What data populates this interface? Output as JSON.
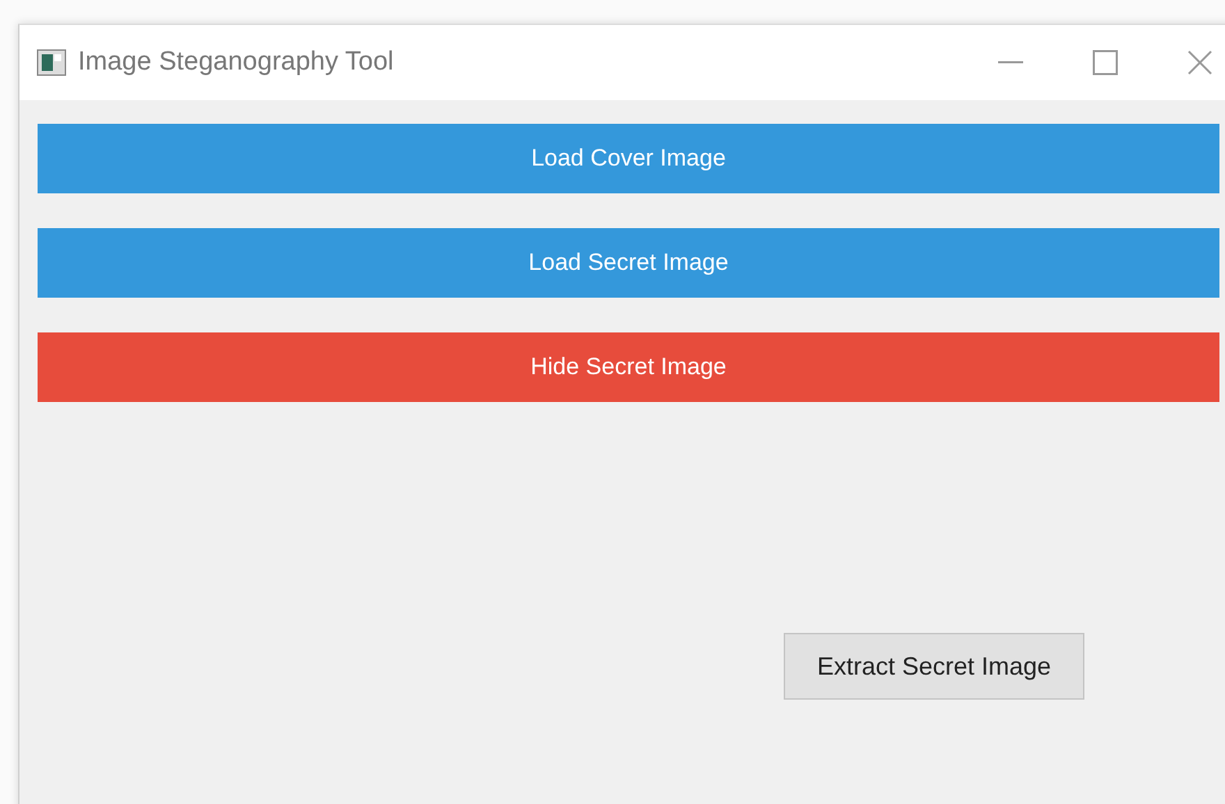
{
  "window": {
    "title": "Image Steganography Tool"
  },
  "buttons": [
    {
      "label": "Load Cover Image",
      "color": "#3498db"
    },
    {
      "label": "Load Secret Image",
      "color": "#3498db"
    },
    {
      "label": "Hide Secret Image",
      "color": "#e74c3c"
    }
  ],
  "extract_button": {
    "label": "Extract Secret Image"
  }
}
